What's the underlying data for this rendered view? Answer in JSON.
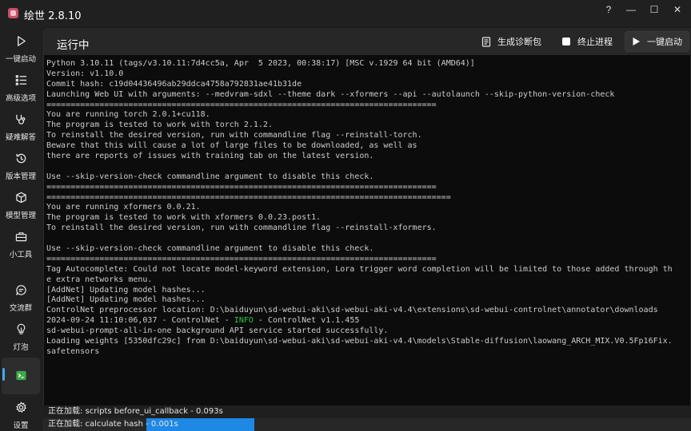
{
  "titlebar": {
    "title": "绘世 2.8.10",
    "help_glyph": "?",
    "minimize_glyph": "—",
    "maximize_glyph": "☐",
    "close_glyph": "✕"
  },
  "sidebar": {
    "items": [
      {
        "label": "一键启动",
        "icon": "play-icon"
      },
      {
        "label": "高级选项",
        "icon": "list-icon"
      },
      {
        "label": "疑难解答",
        "icon": "stethoscope-icon"
      },
      {
        "label": "版本管理",
        "icon": "history-icon"
      },
      {
        "label": "模型管理",
        "icon": "cube-icon"
      },
      {
        "label": "小工具",
        "icon": "toolbox-icon"
      },
      {
        "label": "交流群",
        "icon": "chat-icon"
      },
      {
        "label": "灯泡",
        "icon": "lightbulb-icon"
      },
      {
        "label": "",
        "icon": "terminal-icon",
        "active": true
      },
      {
        "label": "设置",
        "icon": "gear-icon"
      }
    ]
  },
  "header": {
    "title": "运行中",
    "diagnostics_label": "生成诊断包",
    "stop_label": "终止进程",
    "launch_label": "一键启动"
  },
  "console": {
    "lines": [
      "Python 3.10.11 (tags/v3.10.11:7d4cc5a, Apr  5 2023, 00:38:17) [MSC v.1929 64 bit (AMD64)]",
      "Version: v1.10.0",
      "Commit hash: c19d04436496ab29ddca4758a792831ae41b31de",
      "Launching Web UI with arguments: --medvram-sdxl --theme dark --xformers --api --autolaunch --skip-python-version-check",
      "=================================================================================",
      "You are running torch 2.0.1+cu118.",
      "The program is tested to work with torch 2.1.2.",
      "To reinstall the desired version, run with commandline flag --reinstall-torch.",
      "Beware that this will cause a lot of large files to be downloaded, as well as",
      "there are reports of issues with training tab on the latest version.",
      "",
      "Use --skip-version-check commandline argument to disable this check.",
      "=================================================================================",
      "====================================================================================",
      "You are running xformers 0.0.21.",
      "The program is tested to work with xformers 0.0.23.post1.",
      "To reinstall the desired version, run with commandline flag --reinstall-xformers.",
      "",
      "Use --skip-version-check commandline argument to disable this check.",
      "=================================================================================",
      "Tag Autocomplete: Could not locate model-keyword extension, Lora trigger word completion will be limited to those added through th",
      "e extra networks menu.",
      "[AddNet] Updating model hashes...",
      "[AddNet] Updating model hashes...",
      "ControlNet preprocessor location: D:\\baiduyun\\sd-webui-aki\\sd-webui-aki-v4.4\\extensions\\sd-webui-controlnet\\annotator\\downloads",
      "__INFO_LINE__",
      "sd-webui-prompt-all-in-one background API service started successfully.",
      "Loading weights [5350dfc29c] from D:\\baiduyun\\sd-webui-aki\\sd-webui-aki-v4.4\\models\\Stable-diffusion\\laowang_ARCH_MIX.V0.5Fp16Fix.",
      "safetensors"
    ],
    "info_line": {
      "prefix": "2024-09-24 11:10:06,037 - ControlNet - ",
      "level": "INFO",
      "suffix": " - ControlNet v1.1.455"
    }
  },
  "status": {
    "line1": "正在加载: scripts before_ui_callback - 0.093s",
    "line2": "正在加载: calculate hash - 0.001s"
  },
  "colors": {
    "accent": "#4aa3f0",
    "progress": "#1e88e5",
    "info": "#2fc24c"
  }
}
